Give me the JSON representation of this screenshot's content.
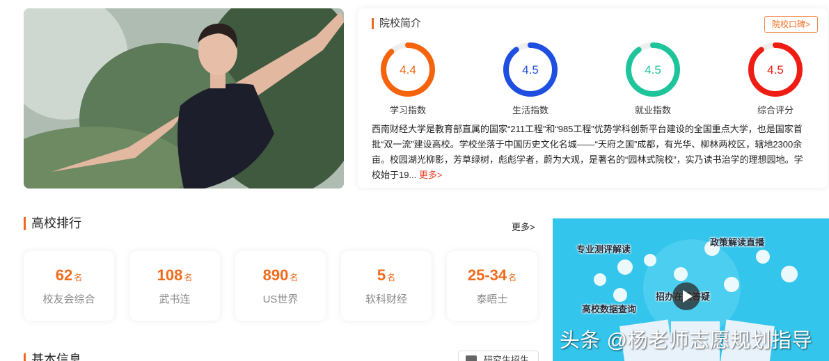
{
  "intro": {
    "title": "院校简介",
    "reputation_button": "院校口碑>",
    "gauges": [
      {
        "value": "4.4",
        "label": "学习指数",
        "color": "#f5640c",
        "fraction": 0.88
      },
      {
        "value": "4.5",
        "label": "生活指数",
        "color": "#1e4fe0",
        "fraction": 0.9
      },
      {
        "value": "4.5",
        "label": "就业指数",
        "color": "#1ec49a",
        "fraction": 0.9
      },
      {
        "value": "4.5",
        "label": "综合评分",
        "color": "#ee1c12",
        "fraction": 0.9
      }
    ],
    "text": "西南财经大学是教育部直属的国家“211工程”和“985工程”优势学科创新平台建设的全国重点大学，也是国家首批“双一流”建设高校。学校坐落于中国历史文化名城——“天府之国”成都，有光华、柳林两校区，辖地2300余亩。校园湖光柳影，芳草绿树，彪彪学者，蔚为大观，是著名的“园林式院校”，实乃读书治学的理想园地。学校始于19...",
    "more_link": "更多>"
  },
  "ranking": {
    "title": "高校排行",
    "more": "更多>",
    "unit": "名",
    "items": [
      {
        "rank": "62",
        "name": "校友会综合"
      },
      {
        "rank": "108",
        "name": "武书连"
      },
      {
        "rank": "890",
        "name": "US世界"
      },
      {
        "rank": "5",
        "name": "软科财经"
      },
      {
        "rank": "25-34",
        "name": "泰晤士"
      }
    ]
  },
  "basic": {
    "title": "基本信息",
    "recruit_button": "研究生招生"
  },
  "video_ad": {
    "labels": {
      "top_left": "专业测评解读",
      "top_right": "政策解读直播",
      "middle": "招办在线答疑",
      "bottom_left": "高校数据查询"
    },
    "watermark": "头条 @杨老师志愿规划指导"
  }
}
